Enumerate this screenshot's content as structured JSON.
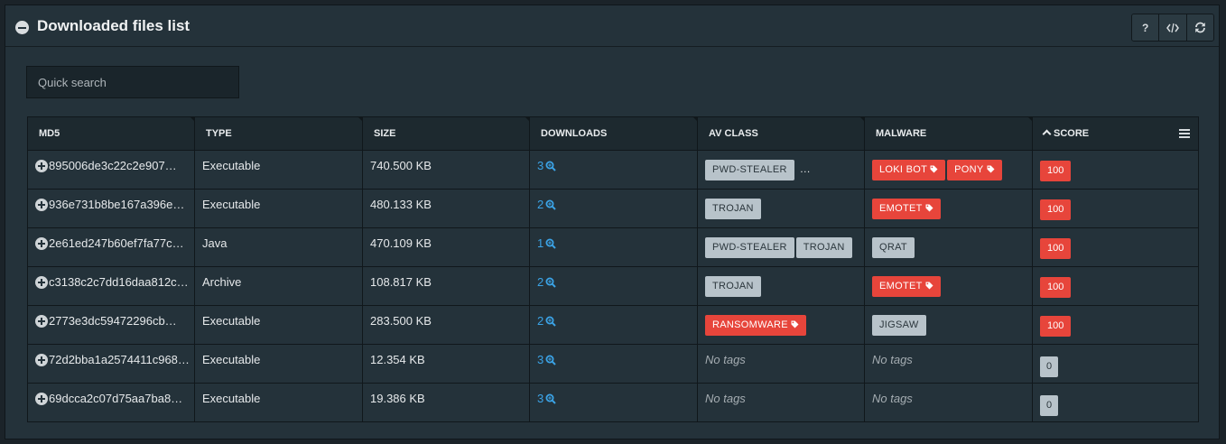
{
  "panel": {
    "title": "Downloaded files list"
  },
  "toolbar": {
    "help_label": "?"
  },
  "search": {
    "placeholder": "Quick search"
  },
  "table": {
    "headers": {
      "md5": "MD5",
      "type": "TYPE",
      "size": "SIZE",
      "downloads": "DOWNLOADS",
      "av_class": "AV CLASS",
      "malware": "MALWARE",
      "score": "SCORE"
    },
    "sort": {
      "column": "score",
      "direction": "ascending-caret"
    },
    "no_tags_label": "No tags",
    "rows": [
      {
        "md5": "895006de3c22c2e907…",
        "type": "Executable",
        "size": "740.500 KB",
        "downloads": "3",
        "av_class": [
          "PWD-STEALER"
        ],
        "av_more": "…",
        "malware": [
          {
            "label": "LOKI BOT",
            "color": "red"
          },
          {
            "label": "PONY",
            "color": "red"
          }
        ],
        "score": "100",
        "score_color": "red"
      },
      {
        "md5": "936e731b8be167a396e…",
        "type": "Executable",
        "size": "480.133 KB",
        "downloads": "2",
        "av_class": [
          "TROJAN"
        ],
        "malware": [
          {
            "label": "EMOTET",
            "color": "red"
          }
        ],
        "score": "100",
        "score_color": "red"
      },
      {
        "md5": "2e61ed247b60ef7fa77c…",
        "type": "Java",
        "size": "470.109 KB",
        "downloads": "1",
        "av_class": [
          "PWD-STEALER",
          "TROJAN"
        ],
        "malware": [
          {
            "label": "QRAT",
            "color": "grey"
          }
        ],
        "score": "100",
        "score_color": "red"
      },
      {
        "md5": "c3138c2c7dd16daa812c…",
        "type": "Archive",
        "size": "108.817 KB",
        "downloads": "2",
        "av_class": [
          "TROJAN"
        ],
        "malware": [
          {
            "label": "EMOTET",
            "color": "red"
          }
        ],
        "score": "100",
        "score_color": "red"
      },
      {
        "md5": "2773e3dc59472296cb…",
        "type": "Executable",
        "size": "283.500 KB",
        "downloads": "2",
        "av_class_red": [
          "RANSOMWARE"
        ],
        "malware": [
          {
            "label": "JIGSAW",
            "color": "grey"
          }
        ],
        "score": "100",
        "score_color": "red"
      },
      {
        "md5": "72d2bba1a2574411c968…",
        "type": "Executable",
        "size": "12.354 KB",
        "downloads": "3",
        "av_class": [],
        "malware": [],
        "score": "0",
        "score_color": "grey"
      },
      {
        "md5": "69dcca2c07d75aa7ba8…",
        "type": "Executable",
        "size": "19.386 KB",
        "downloads": "3",
        "av_class": [],
        "malware": [],
        "score": "0",
        "score_color": "grey"
      }
    ]
  },
  "icons": {
    "collapse": "minus-circle-icon",
    "help": "question-icon",
    "embed": "code-icon",
    "refresh": "refresh-icon",
    "columns_menu": "hamburger-menu-icon",
    "expand_row": "plus-circle-icon",
    "downloads_search": "magnifier-icon",
    "tag": "tag-icon"
  },
  "colors": {
    "danger": "#e7453b",
    "link": "#3ba3e6",
    "neutral_tag": "#b8c3ca"
  }
}
